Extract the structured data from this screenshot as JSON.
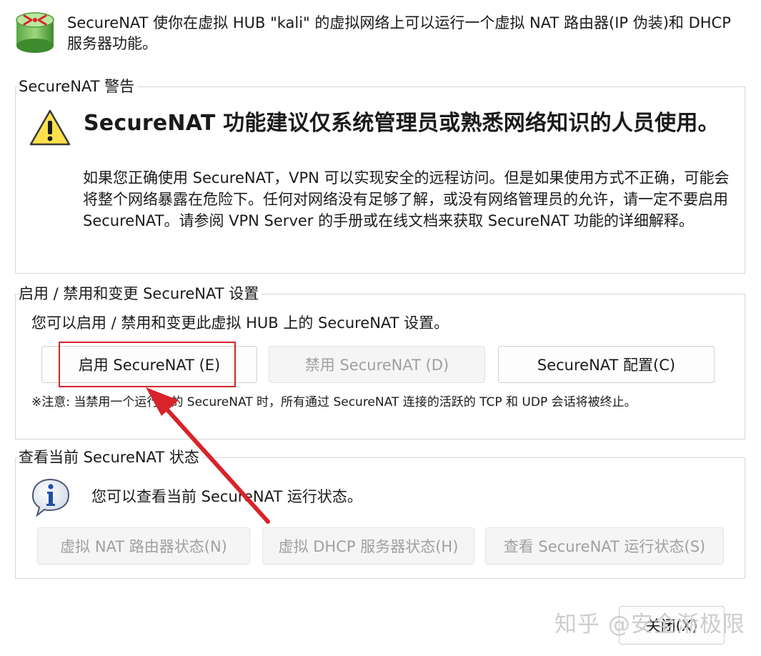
{
  "header": {
    "icon": "network-nat-icon",
    "text": "SecureNAT 使你在虚拟 HUB \"kali\" 的虚拟网络上可以运行一个虚拟 NAT 路由器(IP 伪装)和 DHCP 服务器功能。"
  },
  "warning_group": {
    "title": "SecureNAT 警告",
    "icon": "warning-icon",
    "heading": "SecureNAT 功能建议仅系统管理员或熟悉网络知识的人员使用。",
    "body": "如果您正确使用 SecureNAT，VPN 可以实现安全的远程访问。但是如果使用方式不正确，可能会将整个网络暴露在危险下。任何对网络没有足够了解，或没有网络管理员的允许，请一定不要启用 SecureNAT。请参阅 VPN Server 的手册或在线文档来获取 SecureNAT 功能的详细解释。"
  },
  "enable_group": {
    "title": "启用 / 禁用和变更 SecureNAT 设置",
    "description": "您可以启用 / 禁用和变更此虚拟 HUB 上的 SecureNAT 设置。",
    "buttons": {
      "enable": "启用 SecureNAT (E)",
      "disable": "禁用 SecureNAT (D)",
      "config": "SecureNAT 配置(C)"
    },
    "note": "※注意: 当禁用一个运行中的 SecureNAT 时，所有通过 SecureNAT 连接的活跃的 TCP 和 UDP 会话将被终止。"
  },
  "status_group": {
    "title": "查看当前 SecureNAT 状态",
    "icon": "info-icon",
    "description": "您可以查看当前 SecureNAT 运行状态。",
    "buttons": {
      "nat": "虚拟 NAT 路由器状态(N)",
      "dhcp": "虚拟 DHCP 服务器状态(H)",
      "run": "查看 SecureNAT 运行状态(S)"
    }
  },
  "footer": {
    "close_label": "关闭(X)",
    "watermark": "知乎 @安全渐极限"
  },
  "colors": {
    "annotation_red": "#d8232a",
    "disabled_text": "#a0a0a0",
    "border": "#d7d7d7"
  }
}
